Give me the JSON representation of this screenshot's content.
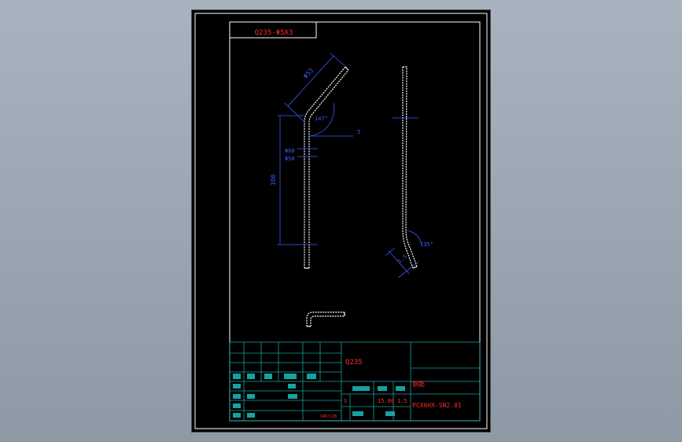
{
  "drawing": {
    "part_label": "Q235-Φ5X3",
    "dimensions": {
      "top_segment_length": "Φ53",
      "bend_angle_top": "147°",
      "right_offset": "5",
      "width_a": "Φ60",
      "width_b": "Φ50",
      "vertical_length": "100",
      "side_angle": "135°",
      "side_small": "1.5"
    },
    "title_block": {
      "material": "Q235",
      "part_name": "钢筋",
      "drawing_number": "PCX6HX-SN2.01",
      "scale_row": [
        "S",
        "",
        "15.60",
        "1:5"
      ],
      "small_label": "CAD/LIB"
    }
  },
  "colors": {
    "background_outer": "#a9b3bf",
    "sheet": "#000000",
    "frame_line": "#ffffff",
    "part_outline": "#ffffff",
    "dimension": "#3b5bff",
    "red_text": "#ff2a2a",
    "table_line": "#17a2a2"
  }
}
